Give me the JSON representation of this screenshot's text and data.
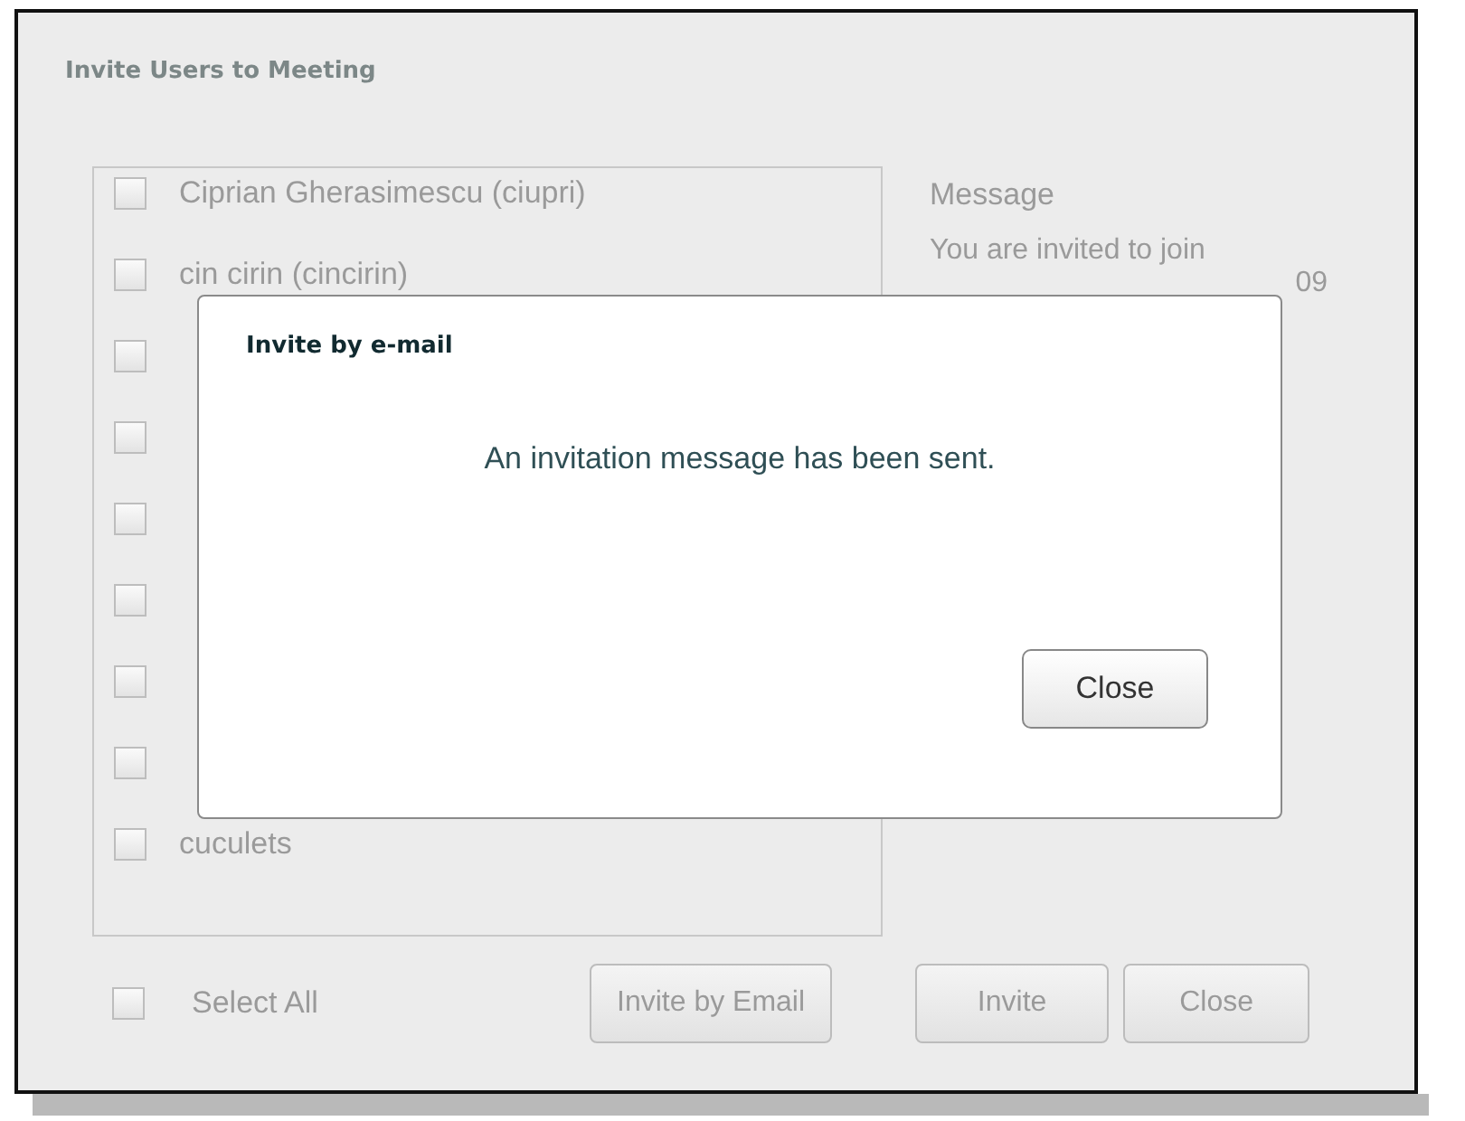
{
  "window": {
    "title": "Invite Users to Meeting"
  },
  "users": [
    {
      "label": "Ciprian Gherasimescu  (ciupri)",
      "checked": false
    },
    {
      "label": "cin cirin (cincirin)",
      "checked": false
    },
    {
      "checked": false
    },
    {
      "checked": false
    },
    {
      "checked": false
    },
    {
      "checked": false
    },
    {
      "checked": false
    },
    {
      "checked": false
    },
    {
      "label": "cuculets",
      "checked": false
    }
  ],
  "message": {
    "label": "Message",
    "lines": [
      "You are invited to join",
      "09"
    ]
  },
  "select_all": {
    "label": "Select All",
    "checked": false
  },
  "buttons": [
    "Invite by Email",
    "Invite",
    "Close"
  ],
  "dialog": {
    "title": "Invite by e-mail",
    "text": "An invitation message has been sent.",
    "button": "Close"
  }
}
